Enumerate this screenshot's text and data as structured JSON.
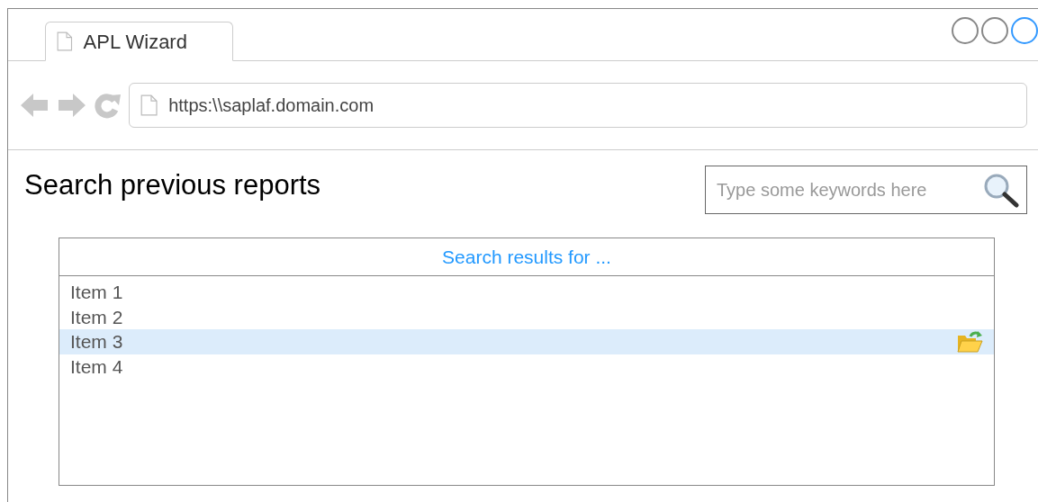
{
  "window_controls": [
    {
      "active": false
    },
    {
      "active": false
    },
    {
      "active": true
    }
  ],
  "tab": {
    "label": "APL Wizard"
  },
  "address_bar": {
    "url": "https:\\\\saplaf.domain.com"
  },
  "page": {
    "title": "Search previous reports",
    "search": {
      "placeholder": "Type some keywords here"
    }
  },
  "results": {
    "header": "Search results for ...",
    "items": [
      {
        "label": "Item 1",
        "selected": false
      },
      {
        "label": "Item 2",
        "selected": false
      },
      {
        "label": "Item 3",
        "selected": true
      },
      {
        "label": "Item 4",
        "selected": false
      }
    ]
  }
}
